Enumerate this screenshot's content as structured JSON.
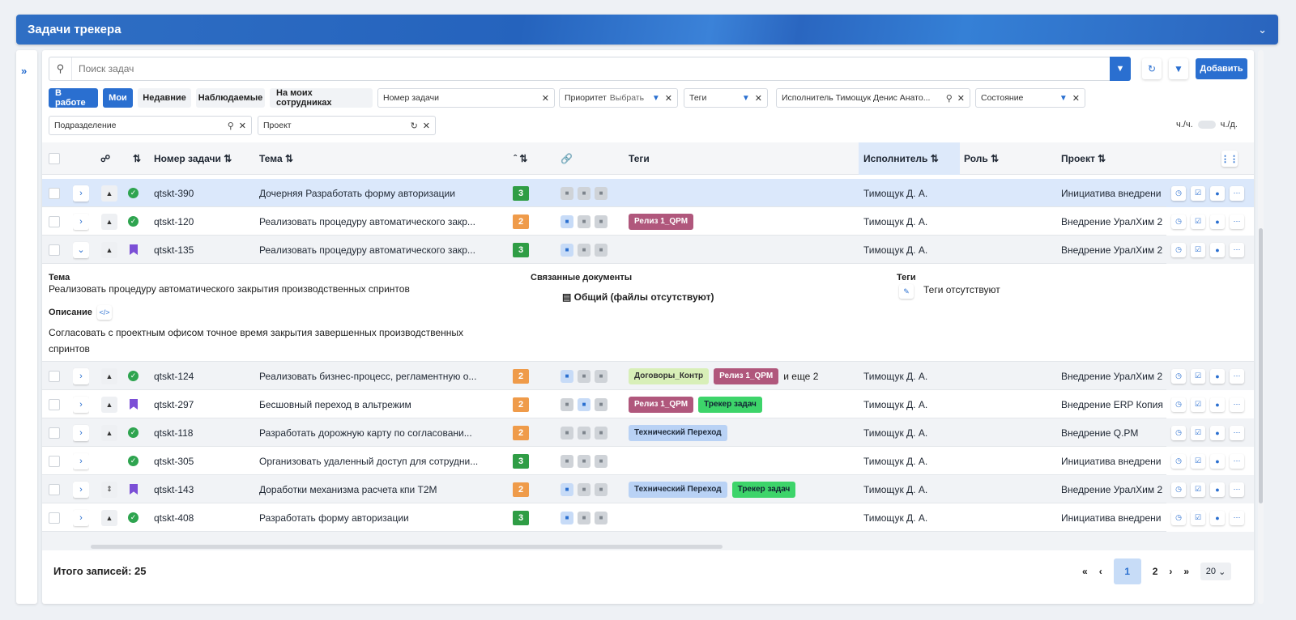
{
  "header": {
    "title": "Задачи трекера"
  },
  "search": {
    "placeholder": "Поиск задач",
    "add_label": "Добавить"
  },
  "chips": [
    "В работе",
    "Мои",
    "Недавние",
    "Наблюдаемые",
    "На моих сотрудниках"
  ],
  "filters": {
    "task_number": "Номер задачи",
    "priority": "Приоритет",
    "priority_value": "Выбрать",
    "tags": "Теги",
    "assignee": "Исполнитель Тимощук Денис Анато...",
    "state": "Состояние",
    "division": "Подразделение",
    "project": "Проект"
  },
  "toggle": {
    "left": "ч./ч.",
    "right": "ч./д."
  },
  "columns": {
    "number": "Номер задачи",
    "subject": "Тема",
    "tags": "Теги",
    "assignee": "Исполнитель",
    "role": "Роль",
    "project": "Проект"
  },
  "rows": [
    {
      "num": "qtskt-390",
      "subject": "Дочерняя Разработать форму авторизации",
      "priority": "3",
      "assignee": "Тимощук Д. А.",
      "project": "Инициатива внедрени"
    },
    {
      "num": "qtskt-120",
      "subject": "Реализовать процедуру автоматического закр...",
      "priority": "2",
      "tags": [
        "Релиз 1_QPM"
      ],
      "assignee": "Тимощук Д. А.",
      "project": "Внедрение УралХим 2"
    },
    {
      "num": "qtskt-135",
      "subject": "Реализовать процедуру автоматического закр...",
      "priority": "3",
      "assignee": "Тимощук Д. А.",
      "project": "Внедрение УралХим 2"
    },
    {
      "num": "qtskt-124",
      "subject": "Реализовать бизнес-процесс, регламентную о...",
      "priority": "2",
      "tags": [
        "Договоры_Контр",
        "Релиз 1_QPM"
      ],
      "more": "и еще 2",
      "assignee": "Тимощук Д. А.",
      "project": "Внедрение УралХим 2"
    },
    {
      "num": "qtskt-297",
      "subject": "Бесшовный переход в альтрежим",
      "priority": "2",
      "tags": [
        "Релиз 1_QPM",
        "Трекер задач"
      ],
      "assignee": "Тимощук Д. А.",
      "project": "Внедрение ERP Копия"
    },
    {
      "num": "qtskt-118",
      "subject": "Разработать дорожную карту по согласовани...",
      "priority": "2",
      "tags": [
        "Технический Переход"
      ],
      "assignee": "Тимощук Д. А.",
      "project": "Внедрение Q.PM"
    },
    {
      "num": "qtskt-305",
      "subject": "Организовать удаленный доступ для сотрудни...",
      "priority": "3",
      "assignee": "Тимощук Д. А.",
      "project": "Инициатива внедрени"
    },
    {
      "num": "qtskt-143",
      "subject": "Доработки механизма расчета кпи Т2М",
      "priority": "2",
      "tags": [
        "Технический Переход",
        "Трекер задач"
      ],
      "assignee": "Тимощук Д. А.",
      "project": "Внедрение УралХим 2"
    },
    {
      "num": "qtskt-408",
      "subject": "Разработать форму авторизации",
      "priority": "3",
      "assignee": "Тимощук Д. А.",
      "project": "Инициатива внедрени"
    }
  ],
  "detail": {
    "subject_label": "Тема",
    "subject": "Реализовать процедуру автоматического закрытия производственных спринтов",
    "desc_label": "Описание",
    "desc_line1": "Согласовать с проектным офисом точное время закрытия завершенных производственных",
    "desc_line2": "спринтов",
    "docs_label": "Связанные документы",
    "docs_item": "Общий (файлы отсутствуют)",
    "tags_label": "Теги",
    "tags_empty": "Теги отсутствуют"
  },
  "footer": {
    "total": "Итого записей: 25",
    "page_current": "1",
    "page_next": "2",
    "page_size": "20"
  },
  "icons": [
    "search-icon",
    "filter-icon",
    "refresh-icon",
    "funnel-icon",
    "chevron-down-icon",
    "expand-icon",
    "hierarchy-icon",
    "link-icon",
    "settings-columns-icon",
    "check-icon",
    "bookmark-icon",
    "chat-icon",
    "file-icon",
    "timer-icon",
    "checklist-icon",
    "more-icon"
  ],
  "colors": {
    "accent": "#2a6fd0",
    "priority2": "#ef9b4a",
    "priority3": "#2f9d45",
    "tag_release": "#b0577c",
    "tag_tracker": "#3dd46a",
    "tag_tech": "#b9d2f5",
    "tag_contracts": "#d8efb8"
  }
}
